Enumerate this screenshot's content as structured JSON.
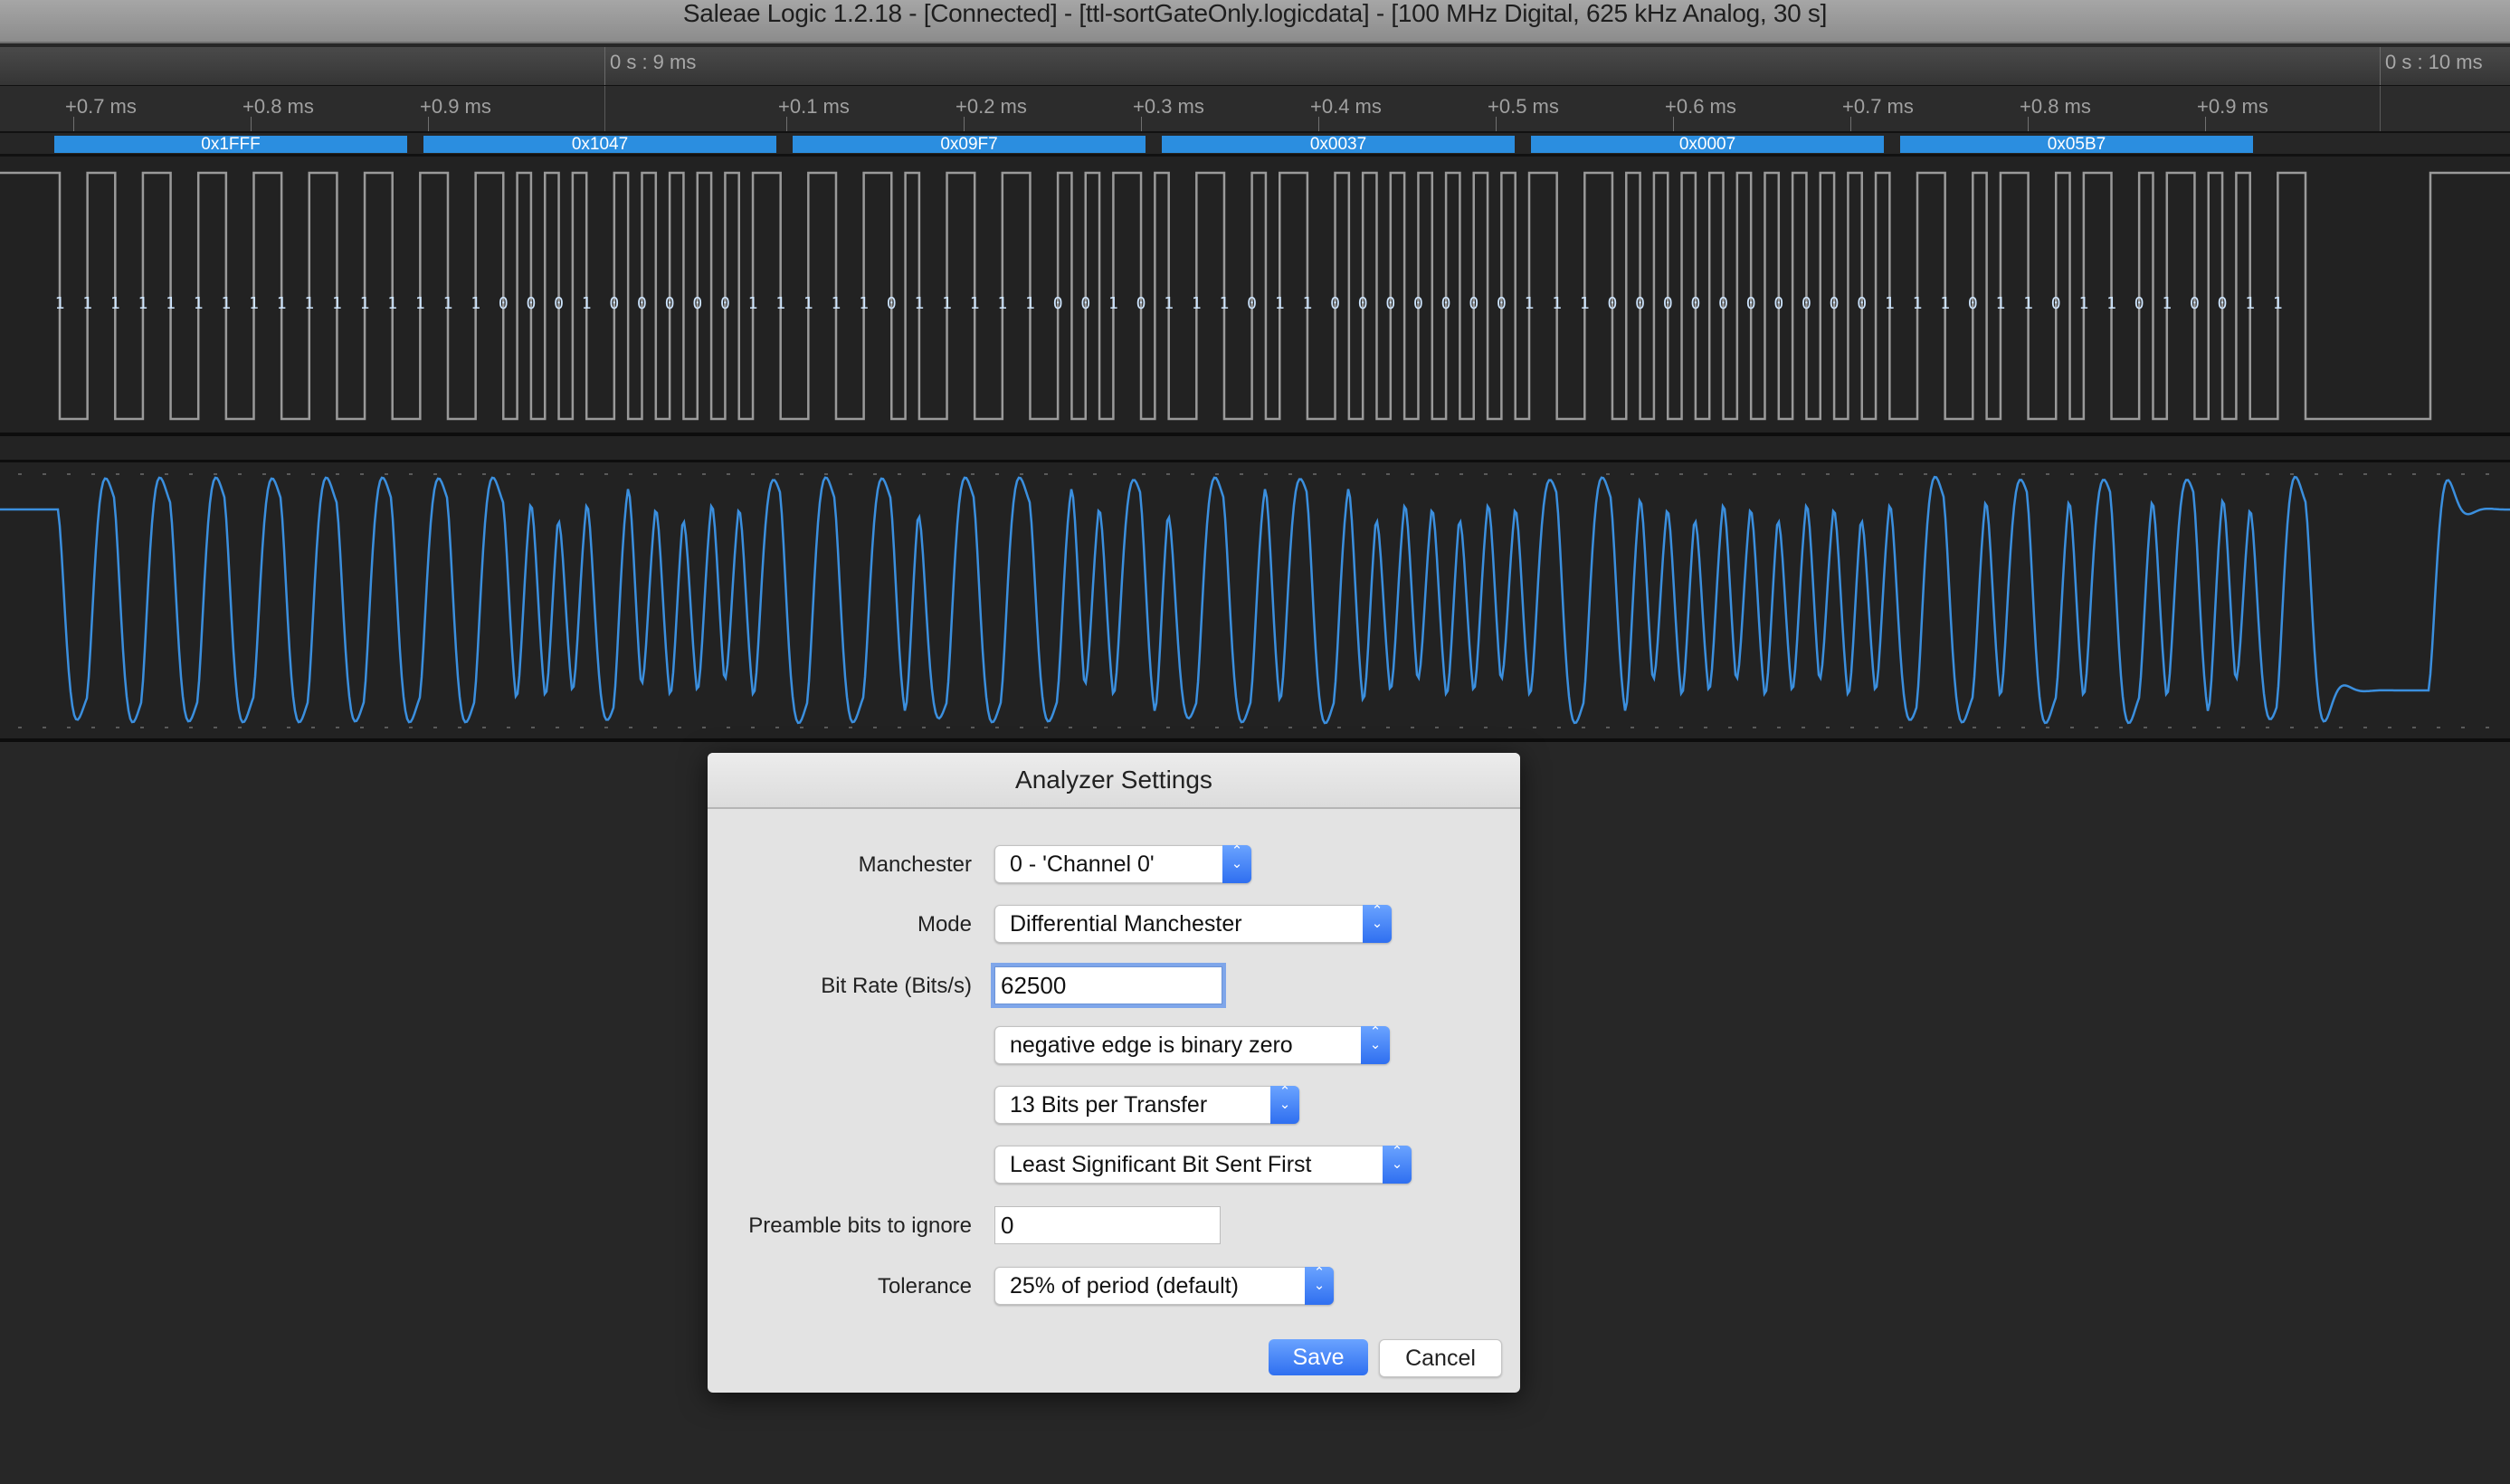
{
  "window": {
    "title": "Saleae Logic 1.2.18 - [Connected] - [ttl-sortGateOnly.logicdata] - [100 MHz Digital, 625 kHz Analog, 30 s]"
  },
  "timeline": {
    "major_marks": [
      "0 s : 9 ms",
      "0 s : 10 ms"
    ],
    "minor_ticks": [
      "+0.7 ms",
      "+0.8 ms",
      "+0.9 ms",
      "+0.1 ms",
      "+0.2 ms",
      "+0.3 ms",
      "+0.4 ms",
      "+0.5 ms",
      "+0.6 ms",
      "+0.7 ms",
      "+0.8 ms",
      "+0.9 ms"
    ]
  },
  "decoder": {
    "frames": [
      "0x1FFF",
      "0x1047",
      "0x09F7",
      "0x0037",
      "0x0007",
      "0x05B7"
    ],
    "frame_color": "#2b8ee0",
    "bits": "111111111111111100010000011111011111001011101100000001110000000000111011011010011"
  },
  "channels": {
    "digital_color": "#9a9a9a",
    "analog_color": "#3b8fde",
    "bit_label_color": "#cfe6ff"
  },
  "dialog": {
    "title": "Analyzer Settings",
    "fields": {
      "manchester": {
        "label": "Manchester",
        "value": "0 - 'Channel 0'"
      },
      "mode": {
        "label": "Mode",
        "value": "Differential Manchester"
      },
      "bit_rate": {
        "label": "Bit Rate (Bits/s)",
        "value": "62500"
      },
      "edge": {
        "value": "negative edge is binary zero"
      },
      "bits_per_transfer": {
        "value": "13 Bits per Transfer"
      },
      "bit_order": {
        "value": "Least Significant Bit Sent First"
      },
      "preamble": {
        "label": "Preamble bits to ignore",
        "value": "0"
      },
      "tolerance": {
        "label": "Tolerance",
        "value": "25% of period (default)"
      }
    },
    "save_label": "Save",
    "cancel_label": "Cancel",
    "accent": "#2f6ff0"
  }
}
